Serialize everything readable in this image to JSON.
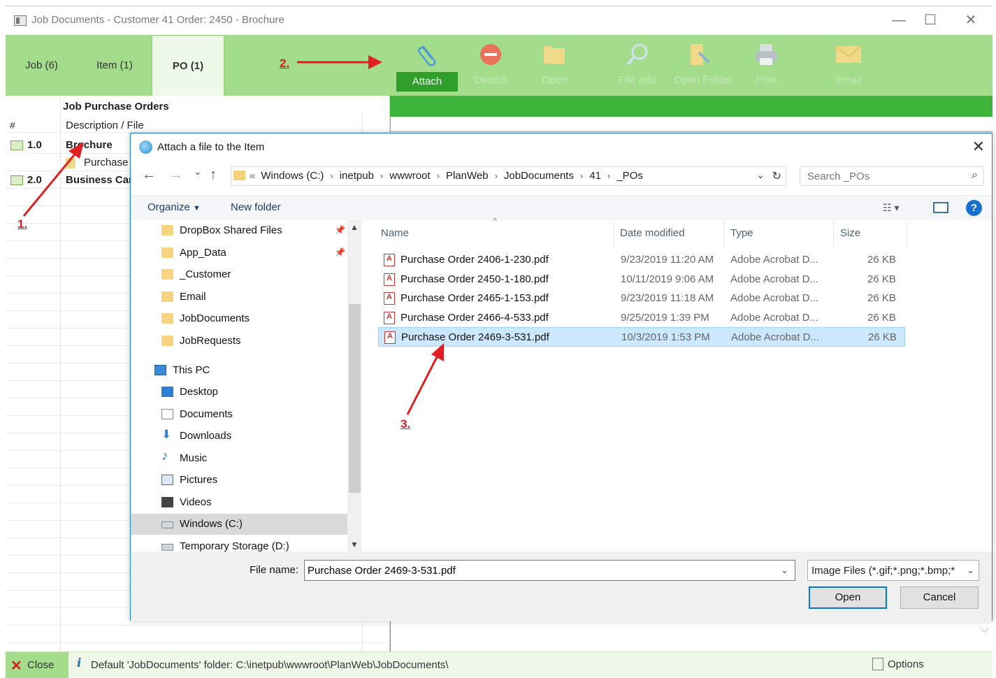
{
  "window": {
    "title": "Job Documents - Customer 41 Order: 2450 - Brochure",
    "minimize": "—",
    "maximize": "☐",
    "close": "✕"
  },
  "tabs": [
    {
      "label": "Job (6)"
    },
    {
      "label": "Item (1)"
    },
    {
      "label": "PO (1)"
    }
  ],
  "toolbar": {
    "attach": "Attach",
    "detach": "Detach",
    "open": "Open",
    "file_info": "File Info",
    "open_folder": "Open Folder",
    "print": "Print",
    "email": "Email"
  },
  "annotations": {
    "one": "1.",
    "two": "2.",
    "three": "3."
  },
  "left_pane": {
    "heading": "Job Purchase Orders",
    "col_num": "#",
    "col_desc": "Description / File",
    "rows": [
      {
        "num": "1.0",
        "desc": "Brochure"
      },
      {
        "num": "",
        "desc": "Purchase"
      },
      {
        "num": "2.0",
        "desc": "Business Card"
      }
    ]
  },
  "dialog": {
    "title": "Attach a file to the Item",
    "close": "✕",
    "nav": {
      "back": "←",
      "forward": "→",
      "recent": "⌄",
      "up": "↑"
    },
    "breadcrumb": {
      "prefix": "«",
      "parts": [
        "Windows (C:)",
        "inetpub",
        "wwwroot",
        "PlanWeb",
        "JobDocuments",
        "41",
        "_POs"
      ]
    },
    "search_placeholder": "Search _POs",
    "organize": "Organize",
    "new_folder": "New folder",
    "nav_items": [
      {
        "label": "DropBox Shared Files",
        "icon": "folder-icon",
        "pinned": true
      },
      {
        "label": "App_Data",
        "icon": "folder-icon",
        "pinned": true
      },
      {
        "label": "_Customer",
        "icon": "folder-icon"
      },
      {
        "label": "Email",
        "icon": "folder-icon"
      },
      {
        "label": "JobDocuments",
        "icon": "folder-icon"
      },
      {
        "label": "JobRequests",
        "icon": "folder-icon"
      },
      {
        "label": "This PC",
        "icon": "computer-icon"
      },
      {
        "label": "Desktop",
        "icon": "desktop-icon"
      },
      {
        "label": "Documents",
        "icon": "documents-icon"
      },
      {
        "label": "Downloads",
        "icon": "downloads-icon"
      },
      {
        "label": "Music",
        "icon": "music-icon"
      },
      {
        "label": "Pictures",
        "icon": "pictures-icon"
      },
      {
        "label": "Videos",
        "icon": "videos-icon"
      },
      {
        "label": "Windows (C:)",
        "icon": "drive-icon",
        "selected": true
      },
      {
        "label": "Temporary Storage (D:)",
        "icon": "drive-icon"
      }
    ],
    "columns": {
      "name": "Name",
      "date": "Date modified",
      "type": "Type",
      "size": "Size"
    },
    "files": [
      {
        "name": "Purchase Order 2406-1-230.pdf",
        "date": "9/23/2019 11:20 AM",
        "type": "Adobe Acrobat D...",
        "size": "26 KB"
      },
      {
        "name": "Purchase Order 2450-1-180.pdf",
        "date": "10/11/2019 9:06 AM",
        "type": "Adobe Acrobat D...",
        "size": "26 KB"
      },
      {
        "name": "Purchase Order 2465-1-153.pdf",
        "date": "9/23/2019 11:18 AM",
        "type": "Adobe Acrobat D...",
        "size": "26 KB"
      },
      {
        "name": "Purchase Order 2466-4-533.pdf",
        "date": "9/25/2019 1:39 PM",
        "type": "Adobe Acrobat D...",
        "size": "26 KB"
      },
      {
        "name": "Purchase Order 2469-3-531.pdf",
        "date": "10/3/2019 1:53 PM",
        "type": "Adobe Acrobat D...",
        "size": "26 KB",
        "selected": true
      }
    ],
    "file_name_label": "File name:",
    "file_name_value": "Purchase Order 2469-3-531.pdf",
    "file_type": "Image Files (*.gif;*.png;*.bmp;*",
    "open_button": "Open",
    "cancel_button": "Cancel"
  },
  "status": {
    "close": "Close",
    "text": "Default 'JobDocuments' folder: C:\\inetpub\\wwwroot\\PlanWeb\\JobDocuments\\",
    "options": "Options"
  }
}
